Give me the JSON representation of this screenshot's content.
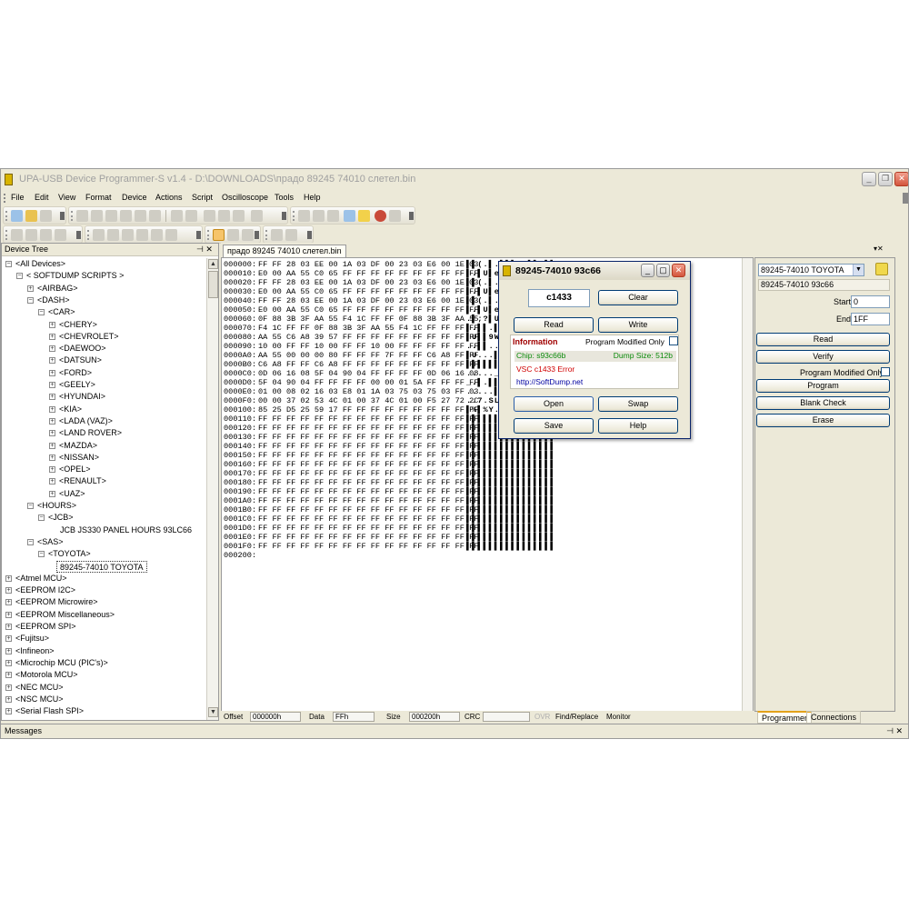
{
  "window": {
    "title": "UPA-USB Device Programmer-S v1.4 - D:\\DOWNLOADS\\прадо 89245 74010 слетел.bin"
  },
  "menu": [
    "File",
    "Edit",
    "View",
    "Format",
    "Device",
    "Actions",
    "Script",
    "Oscilloscope",
    "Tools",
    "Help"
  ],
  "device_tree": {
    "header": "Device Tree",
    "pin": "⊣ ✕",
    "nodes": [
      {
        "label": "<All Devices>",
        "level": 0,
        "toggle": "⊟"
      },
      {
        "label": "< SOFTDUMP SCRIPTS >",
        "level": 1,
        "toggle": "⊟"
      },
      {
        "label": "<AIRBAG>",
        "level": 2,
        "toggle": "⊞"
      },
      {
        "label": "<DASH>",
        "level": 2,
        "toggle": "⊟"
      },
      {
        "label": "<CAR>",
        "level": 3,
        "toggle": "⊟"
      },
      {
        "label": "<CHERY>",
        "level": 4,
        "toggle": "⊞"
      },
      {
        "label": "<CHEVROLET>",
        "level": 4,
        "toggle": "⊞"
      },
      {
        "label": "<DAEWOO>",
        "level": 4,
        "toggle": "⊞"
      },
      {
        "label": "<DATSUN>",
        "level": 4,
        "toggle": "⊞"
      },
      {
        "label": "<FORD>",
        "level": 4,
        "toggle": "⊞"
      },
      {
        "label": "<GEELY>",
        "level": 4,
        "toggle": "⊞"
      },
      {
        "label": "<HYUNDAI>",
        "level": 4,
        "toggle": "⊞"
      },
      {
        "label": "<KIA>",
        "level": 4,
        "toggle": "⊞"
      },
      {
        "label": "<LADA (VAZ)>",
        "level": 4,
        "toggle": "⊞"
      },
      {
        "label": "<LAND ROVER>",
        "level": 4,
        "toggle": "⊞"
      },
      {
        "label": "<MAZDA>",
        "level": 4,
        "toggle": "⊞"
      },
      {
        "label": "<NISSAN>",
        "level": 4,
        "toggle": "⊞"
      },
      {
        "label": "<OPEL>",
        "level": 4,
        "toggle": "⊞"
      },
      {
        "label": "<RENAULT>",
        "level": 4,
        "toggle": "⊞"
      },
      {
        "label": "<UAZ>",
        "level": 4,
        "toggle": "⊞"
      },
      {
        "label": "<HOURS>",
        "level": 2,
        "toggle": "⊟"
      },
      {
        "label": "<JCB>",
        "level": 3,
        "toggle": "⊟"
      },
      {
        "label": "JCB JS330 PANEL HOURS 93LC66",
        "level": 5,
        "toggle": ""
      },
      {
        "label": "<SAS>",
        "level": 2,
        "toggle": "⊟"
      },
      {
        "label": "<TOYOTA>",
        "level": 3,
        "toggle": "⊟"
      },
      {
        "label": "89245-74010 TOYOTA",
        "level": 5,
        "toggle": "",
        "selected": true
      },
      {
        "label": "<Atmel MCU>",
        "level": 0,
        "toggle": "⊞"
      },
      {
        "label": "<EEPROM I2C>",
        "level": 0,
        "toggle": "⊞"
      },
      {
        "label": "<EEPROM Microwire>",
        "level": 0,
        "toggle": "⊞"
      },
      {
        "label": "<EEPROM Miscellaneous>",
        "level": 0,
        "toggle": "⊞"
      },
      {
        "label": "<EEPROM SPI>",
        "level": 0,
        "toggle": "⊞"
      },
      {
        "label": "<Fujitsu>",
        "level": 0,
        "toggle": "⊞"
      },
      {
        "label": "<Infineon>",
        "level": 0,
        "toggle": "⊞"
      },
      {
        "label": "<Microchip MCU (PIC's)>",
        "level": 0,
        "toggle": "⊞"
      },
      {
        "label": "<Motorola MCU>",
        "level": 0,
        "toggle": "⊞"
      },
      {
        "label": "<NEC MCU>",
        "level": 0,
        "toggle": "⊞"
      },
      {
        "label": "<NSC MCU>",
        "level": 0,
        "toggle": "⊞"
      },
      {
        "label": "<Serial Flash SPI>",
        "level": 0,
        "toggle": "⊞"
      }
    ]
  },
  "editor": {
    "tab": "прадо 89245 74010 слетел.bin",
    "close_controls": "▾✕",
    "hex_rows": [
      {
        "off": "000000:",
        "bytes": "FF FF 28 03 EE 00 1A 03 DF 00 23 03 E6 00 1E 03",
        "ascii": "▌▌(.▌.▌▌▌.#▌▌.▌▌"
      },
      {
        "off": "000010:",
        "bytes": "E0 00 AA 55 C0 65 FF FF FF FF FF FF FF FF FF FF",
        "ascii": "▌.▌U▌e▌▌▌▌▌▌▌▌▌▌"
      },
      {
        "off": "000020:",
        "bytes": "FF FF 28 03 EE 00 1A 03 DF 00 23 03 E6 00 1E 03",
        "ascii": "▌▌(.▌.▌▌▌.#▌▌.▌▌"
      },
      {
        "off": "000030:",
        "bytes": "E0 00 AA 55 C0 65 FF FF FF FF FF FF FF FF FF FF",
        "ascii": "▌.▌U▌e▌▌▌▌▌▌▌▌▌▌"
      },
      {
        "off": "000040:",
        "bytes": "FF FF 28 03 EE 00 1A 03 DF 00 23 03 E6 00 1E 03",
        "ascii": "▌▌(.▌.▌▌▌.#▌▌.▌▌"
      },
      {
        "off": "000050:",
        "bytes": "E0 00 AA 55 C0 65 FF FF FF FF FF FF FF FF FF FF",
        "ascii": "▌.▌U▌e▌▌▌▌▌▌▌▌▌▌"
      },
      {
        "off": "000060:",
        "bytes": "0F 88 3B 3F AA 55 F4 1C FF FF 0F 88 3B 3F AA 55",
        "ascii": ".▌;?▌U▌.▌▌.▌;?▌U"
      },
      {
        "off": "000070:",
        "bytes": "F4 1C FF FF 0F 88 3B 3F AA 55 F4 1C FF FF FF FF",
        "ascii": "▌.▌▌.▌;?▌U▌.▌▌▌▌"
      },
      {
        "off": "000080:",
        "bytes": "AA 55 C6 A8 39 57 FF FF FF FF FF FF FF FF FF FF",
        "ascii": "▌U▌▌9W▌▌▌▌▌▌▌▌▌▌"
      },
      {
        "off": "000090:",
        "bytes": "10 00 FF FF 10 00 FF FF 10 00 FF FF FF FF FF FF",
        "ascii": "..▌▌..▌▌..▌▌▌▌▌▌"
      },
      {
        "off": "0000A0:",
        "bytes": "AA 55 00 00 00 80 FF FF FF 7F FF FF C6 A8 FF FF",
        "ascii": "▌U...▌▌▌▌.▌▌▌▌▌▌"
      },
      {
        "off": "0000B0:",
        "bytes": "C6 A8 FF FF C6 A8 FF FF FF FF FF FF FF FF FF FF",
        "ascii": "▌▌▌▌▌▌▌▌▌▌▌▌▌▌▌▌"
      },
      {
        "off": "0000C0:",
        "bytes": "0D 06 16 08 5F 04 90 04 FF FF FF FF 0D 06 16 08",
        "ascii": "....._.▌.▌▌▌▌...."
      },
      {
        "off": "0000D0:",
        "bytes": "5F 04 90 04 FF FF FF FF 00 00 01 5A FF FF FF FF",
        "ascii": "_.▌.▌▌▌▌...Z▌▌▌▌"
      },
      {
        "off": "0000E0:",
        "bytes": "01 00 08 02 16 03 E8 01 1A 03 75 03 75 03 FF 03",
        "ascii": ".....▌.▌.u.u.▌."
      },
      {
        "off": "0000F0:",
        "bytes": "00 00 37 02 53 4C 01 00 37 4C 01 00 F5 27 72 2C",
        "ascii": "..7.SL..7L..▌'r,"
      },
      {
        "off": "000100:",
        "bytes": "85 25 D5 25 59 17 FF FF FF FF FF FF FF FF FF FF",
        "ascii": "▌%▌%Y.▌▌▌▌▌▌▌▌▌▌"
      },
      {
        "off": "000110:",
        "bytes": "FF FF FF FF FF FF FF FF FF FF FF FF FF FF FF FF",
        "ascii": "▌▌▌▌▌▌▌▌▌▌▌▌▌▌▌▌"
      },
      {
        "off": "000120:",
        "bytes": "FF FF FF FF FF FF FF FF FF FF FF FF FF FF FF FF",
        "ascii": "▌▌▌▌▌▌▌▌▌▌▌▌▌▌▌▌"
      },
      {
        "off": "000130:",
        "bytes": "FF FF FF FF FF FF FF FF FF FF FF FF FF FF FF FF",
        "ascii": "▌▌▌▌▌▌▌▌▌▌▌▌▌▌▌▌"
      },
      {
        "off": "000140:",
        "bytes": "FF FF FF FF FF FF FF FF FF FF FF FF FF FF FF FF",
        "ascii": "▌▌▌▌▌▌▌▌▌▌▌▌▌▌▌▌"
      },
      {
        "off": "000150:",
        "bytes": "FF FF FF FF FF FF FF FF FF FF FF FF FF FF FF FF",
        "ascii": "▌▌▌▌▌▌▌▌▌▌▌▌▌▌▌▌"
      },
      {
        "off": "000160:",
        "bytes": "FF FF FF FF FF FF FF FF FF FF FF FF FF FF FF FF",
        "ascii": "▌▌▌▌▌▌▌▌▌▌▌▌▌▌▌▌"
      },
      {
        "off": "000170:",
        "bytes": "FF FF FF FF FF FF FF FF FF FF FF FF FF FF FF FF",
        "ascii": "▌▌▌▌▌▌▌▌▌▌▌▌▌▌▌▌"
      },
      {
        "off": "000180:",
        "bytes": "FF FF FF FF FF FF FF FF FF FF FF FF FF FF FF FF",
        "ascii": "▌▌▌▌▌▌▌▌▌▌▌▌▌▌▌▌"
      },
      {
        "off": "000190:",
        "bytes": "FF FF FF FF FF FF FF FF FF FF FF FF FF FF FF FF",
        "ascii": "▌▌▌▌▌▌▌▌▌▌▌▌▌▌▌▌"
      },
      {
        "off": "0001A0:",
        "bytes": "FF FF FF FF FF FF FF FF FF FF FF FF FF FF FF FF",
        "ascii": "▌▌▌▌▌▌▌▌▌▌▌▌▌▌▌▌"
      },
      {
        "off": "0001B0:",
        "bytes": "FF FF FF FF FF FF FF FF FF FF FF FF FF FF FF FF",
        "ascii": "▌▌▌▌▌▌▌▌▌▌▌▌▌▌▌▌"
      },
      {
        "off": "0001C0:",
        "bytes": "FF FF FF FF FF FF FF FF FF FF FF FF FF FF FF FF",
        "ascii": "▌▌▌▌▌▌▌▌▌▌▌▌▌▌▌▌"
      },
      {
        "off": "0001D0:",
        "bytes": "FF FF FF FF FF FF FF FF FF FF FF FF FF FF FF FF",
        "ascii": "▌▌▌▌▌▌▌▌▌▌▌▌▌▌▌▌"
      },
      {
        "off": "0001E0:",
        "bytes": "FF FF FF FF FF FF FF FF FF FF FF FF FF FF FF FF",
        "ascii": "▌▌▌▌▌▌▌▌▌▌▌▌▌▌▌▌"
      },
      {
        "off": "0001F0:",
        "bytes": "FF FF FF FF FF FF FF FF FF FF FF FF FF FF FF FF",
        "ascii": "▌▌▌▌▌▌▌▌▌▌▌▌▌▌▌▌"
      },
      {
        "off": "000200:",
        "bytes": "",
        "ascii": ""
      }
    ]
  },
  "status": {
    "offset_label": "Offset",
    "offset_value": "000000h",
    "data_label": "Data",
    "data_value": "FFh",
    "size_label": "Size",
    "size_value": "000200h",
    "crc_label": "CRC",
    "crc_value": "",
    "ovr_label": "OVR",
    "find_label": "Find/Replace",
    "monitor_label": "Monitor"
  },
  "programmer": {
    "device": "89245-74010 TOYOTA",
    "chip": "89245-74010 93c66",
    "start_label": "Start",
    "start_value": "0",
    "end_label": "End",
    "end_value": "1FF",
    "read": "Read",
    "verify": "Verify",
    "modified_only": "Program Modified Only",
    "program": "Program",
    "blank_check": "Blank Check",
    "erase": "Erase",
    "tabs": [
      "Programmer",
      "Connections"
    ]
  },
  "messages": {
    "label": "Messages",
    "controls": "⊣ ✕"
  },
  "dialog": {
    "title": "89245-74010 93c66",
    "code": "c1433",
    "clear": "Clear",
    "read": "Read",
    "write": "Write",
    "modified_only": "Program Modified Only",
    "info_header": "Information",
    "chip_line": "Chip: s93c66b",
    "dump_size": "Dump Size: 512b",
    "error_line": "VSC c1433 Error",
    "url": "http://SoftDump.net",
    "open": "Open",
    "swap": "Swap",
    "save": "Save",
    "help": "Help"
  },
  "colors": {
    "chrome": "#ece9d8",
    "selection_accent": "#e3a21a",
    "error_red": "#d00000",
    "ok_green": "#0a8a0a",
    "link_blue": "#0000a0"
  }
}
